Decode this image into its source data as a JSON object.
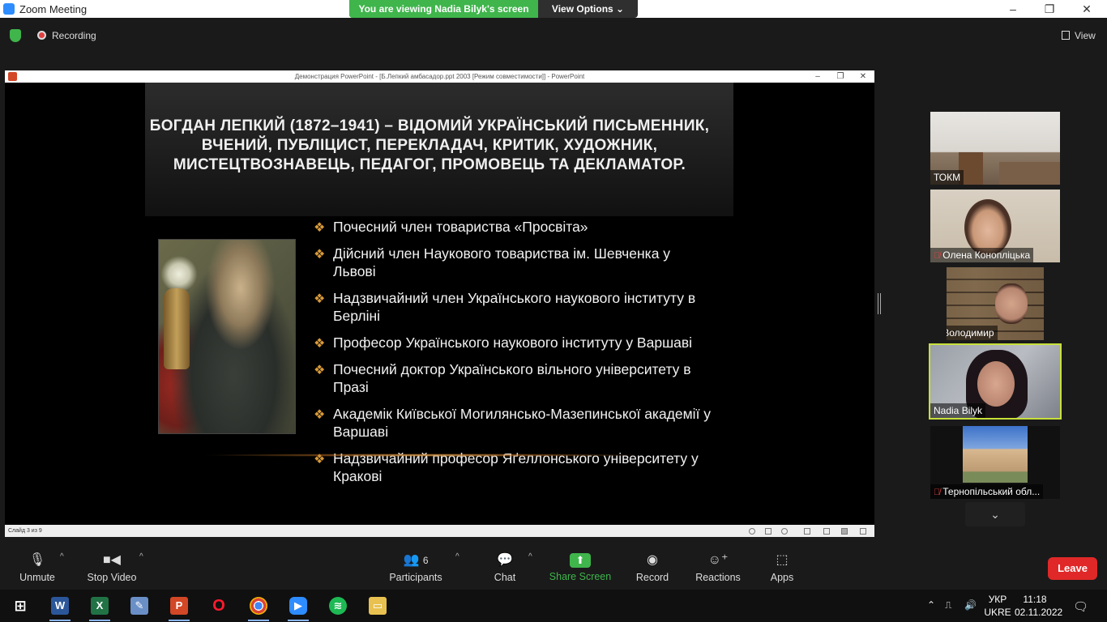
{
  "window": {
    "title": "Zoom Meeting",
    "viewing_banner": "You are viewing Nadia Bilyk's screen",
    "view_options": "View Options ⌄",
    "minimize": "–",
    "maximize": "❐",
    "close": "✕"
  },
  "topbar": {
    "recording_label": "Recording",
    "view_label": "View"
  },
  "ppt": {
    "title": "Демонстрация PowerPoint - [Б.Лепкий амбасадор.ppt 2003 [Режим совместимости]] - PowerPoint",
    "status_slide": "Слайд 3 из 9",
    "slide": {
      "title": "БОГДАН ЛЕПКИЙ (1872–1941) – ВІДОМИЙ УКРАЇНСЬКИЙ ПИСЬМЕННИК, ВЧЕНИЙ, ПУБЛІЦИСТ, ПЕРЕКЛАДАЧ, КРИТИК, ХУДОЖНИК, МИСТЕЦТВОЗНАВЕЦЬ, ПЕДАГОГ, ПРОМОВЕЦЬ ТА ДЕКЛАМАТОР.",
      "bullets": [
        "Почесний член товариства «Просвіта»",
        "Дійсний член Наукового товариства ім. Шевченка у Львові",
        "Надзвичайний член Українського наукового інституту в Берліні",
        "Професор Українського наукового інституту у Варшаві",
        "Почесний доктор Українського вільного університету в Празі",
        "Академік Київської Могилянсько-Мазепинської академії у Варшаві",
        "Надзвичайний професор Яґеллонського університету у Кракові"
      ]
    }
  },
  "participants": [
    {
      "name": "ТОКМ",
      "muted": false
    },
    {
      "name": "Олена Коноплiцька",
      "muted": true
    },
    {
      "name": "Володимир",
      "muted": true
    },
    {
      "name": "Nadia Bilyk",
      "muted": false,
      "active_speaker": true
    },
    {
      "name": "Тернопільський обл...",
      "muted": true
    }
  ],
  "toolbar": {
    "unmute": "Unmute",
    "stop_video": "Stop Video",
    "participants": "Participants",
    "participants_count": "6",
    "chat": "Chat",
    "share_screen": "Share Screen",
    "record": "Record",
    "reactions": "Reactions",
    "apps": "Apps",
    "leave": "Leave"
  },
  "taskbar": {
    "lang_top": "УКР",
    "lang_bottom": "UKRE",
    "time": "11:18",
    "date": "02.11.2022"
  },
  "colors": {
    "zoom_green": "#3fb54c",
    "leave_red": "#e02828",
    "active_speaker_border": "#c8e03a",
    "bullet_accent": "#d89a3a"
  }
}
